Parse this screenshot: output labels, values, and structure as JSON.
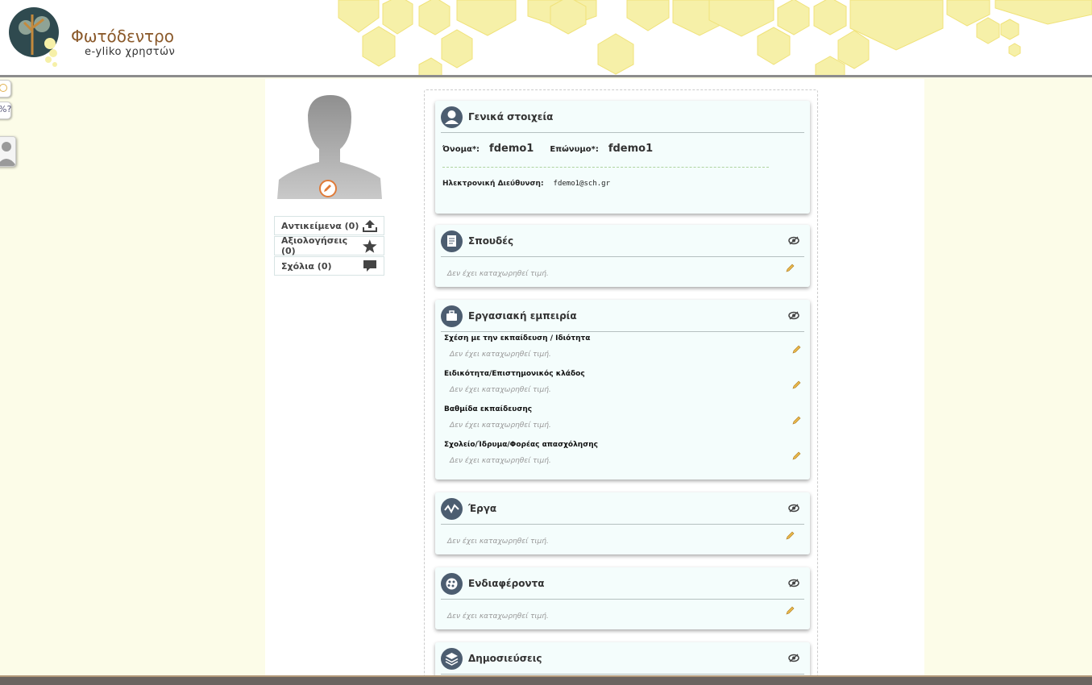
{
  "header": {
    "logo_title": "Φωτόδεντρο",
    "logo_subtitle": "e-yliko χρηστών"
  },
  "profile": {
    "stats": [
      {
        "label": "Αντικείμενα (0)",
        "icon": "upload-icon"
      },
      {
        "label": "Αξιολογήσεις (0)",
        "icon": "star-icon"
      },
      {
        "label": "Σχόλια (0)",
        "icon": "comment-icon"
      }
    ]
  },
  "general": {
    "title": "Γενικά στοιχεία",
    "name_label": "Όνομα*:",
    "name_value": "fdemo1",
    "surname_label": "Επώνυμο*:",
    "surname_value": "fdemo1",
    "email_label": "Ηλεκτρονική Διεύθυνση:",
    "email_value": "fdemo1@sch.gr"
  },
  "empty_text": "Δεν έχει καταχωρηθεί τιμή.",
  "sections": {
    "studies": {
      "title": "Σπουδές",
      "icon": "document-icon"
    },
    "work": {
      "title": "Εργασιακή εμπειρία",
      "icon": "briefcase-icon",
      "fields": [
        "Σχέση με την εκπαίδευση / Ιδιότητα",
        "Ειδικότητα/Επιστημονικός κλάδος",
        "Βαθμίδα εκπαίδευσης",
        "Σχολείο/Ίδρυμα/Φορέας απασχόλησης"
      ]
    },
    "projects": {
      "title": "Έργα",
      "icon": "activity-icon"
    },
    "interests": {
      "title": "Ενδιαφέροντα",
      "icon": "palette-icon"
    },
    "publications": {
      "title": "Δημοσιεύσεις",
      "icon": "layers-icon"
    }
  },
  "colors": {
    "accent_orange": "#e07b39",
    "section_icon_bg": "#4c5d70",
    "card_bg": "#f4fdfc",
    "page_bg": "#fcfce8",
    "honeycomb": "#f5ee9e"
  }
}
